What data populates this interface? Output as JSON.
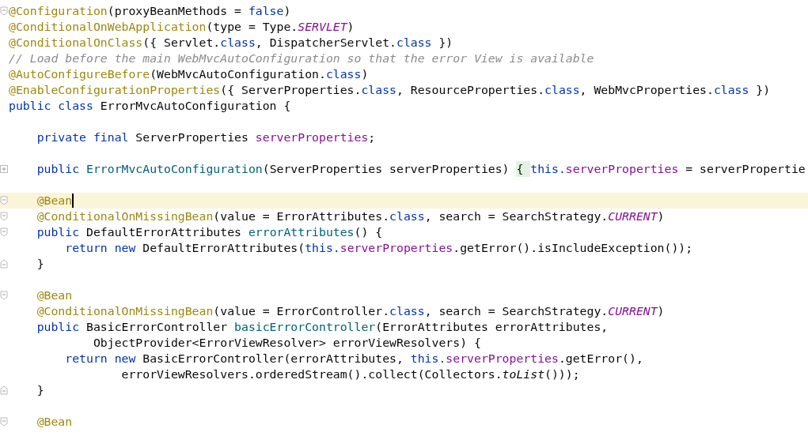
{
  "editor": {
    "lines": [
      {
        "kind": "code",
        "fold_start": true,
        "fold_end": false,
        "collapsed": false,
        "current": false,
        "tokens": [
          {
            "kind": "annotation",
            "text": "@Configuration"
          },
          {
            "kind": "plain",
            "text": "(proxyBeanMethods = "
          },
          {
            "kind": "keyword",
            "text": "false"
          },
          {
            "kind": "plain",
            "text": ")"
          }
        ]
      },
      {
        "kind": "code",
        "fold_start": false,
        "fold_end": false,
        "collapsed": false,
        "current": false,
        "tokens": [
          {
            "kind": "annotation",
            "text": "@ConditionalOnWebApplication"
          },
          {
            "kind": "plain",
            "text": "(type = Type."
          },
          {
            "kind": "constant",
            "text": "SERVLET"
          },
          {
            "kind": "plain",
            "text": ")"
          }
        ]
      },
      {
        "kind": "code",
        "fold_start": false,
        "fold_end": false,
        "collapsed": false,
        "current": false,
        "tokens": [
          {
            "kind": "annotation",
            "text": "@ConditionalOnClass"
          },
          {
            "kind": "plain",
            "text": "({ Servlet."
          },
          {
            "kind": "keyword",
            "text": "class"
          },
          {
            "kind": "plain",
            "text": ", DispatcherServlet."
          },
          {
            "kind": "keyword",
            "text": "class"
          },
          {
            "kind": "plain",
            "text": " })"
          }
        ]
      },
      {
        "kind": "code",
        "fold_start": false,
        "fold_end": false,
        "collapsed": false,
        "current": false,
        "tokens": [
          {
            "kind": "comment",
            "text": "// Load before the main WebMvcAutoConfiguration so that the error View is available"
          }
        ]
      },
      {
        "kind": "code",
        "fold_start": false,
        "fold_end": false,
        "collapsed": false,
        "current": false,
        "tokens": [
          {
            "kind": "annotation",
            "text": "@AutoConfigureBefore"
          },
          {
            "kind": "plain",
            "text": "(WebMvcAutoConfiguration."
          },
          {
            "kind": "keyword",
            "text": "class"
          },
          {
            "kind": "plain",
            "text": ")"
          }
        ]
      },
      {
        "kind": "code",
        "fold_start": false,
        "fold_end": false,
        "collapsed": false,
        "current": false,
        "tokens": [
          {
            "kind": "annotation",
            "text": "@EnableConfigurationProperties"
          },
          {
            "kind": "plain",
            "text": "({ ServerProperties."
          },
          {
            "kind": "keyword",
            "text": "class"
          },
          {
            "kind": "plain",
            "text": ", ResourceProperties."
          },
          {
            "kind": "keyword",
            "text": "class"
          },
          {
            "kind": "plain",
            "text": ", WebMvcProperties."
          },
          {
            "kind": "keyword",
            "text": "class"
          },
          {
            "kind": "plain",
            "text": " })"
          }
        ]
      },
      {
        "kind": "code",
        "fold_start": false,
        "fold_end": false,
        "collapsed": false,
        "current": false,
        "tokens": [
          {
            "kind": "keyword",
            "text": "public class "
          },
          {
            "kind": "plain",
            "text": "ErrorMvcAutoConfiguration {"
          }
        ]
      },
      {
        "kind": "blank",
        "fold_start": false,
        "fold_end": false,
        "collapsed": false,
        "current": false
      },
      {
        "kind": "code",
        "fold_start": false,
        "fold_end": false,
        "collapsed": false,
        "current": false,
        "tokens": [
          {
            "kind": "keyword",
            "text": "    private final "
          },
          {
            "kind": "plain",
            "text": "ServerProperties "
          },
          {
            "kind": "field",
            "text": "serverProperties"
          },
          {
            "kind": "plain",
            "text": ";"
          }
        ]
      },
      {
        "kind": "blank",
        "fold_start": false,
        "fold_end": false,
        "collapsed": false,
        "current": false
      },
      {
        "kind": "code",
        "fold_start": false,
        "fold_end": false,
        "collapsed": true,
        "current": false,
        "tokens": [
          {
            "kind": "keyword",
            "text": "    public "
          },
          {
            "kind": "method",
            "text": "ErrorMvcAutoConfiguration"
          },
          {
            "kind": "plain",
            "text": "(ServerProperties serverProperties) "
          },
          {
            "kind": "folded",
            "text": "{ "
          },
          {
            "kind": "keyword",
            "text": "this."
          },
          {
            "kind": "field",
            "text": "serverProperties"
          },
          {
            "kind": "plain",
            "text": " = serverPropertie"
          }
        ]
      },
      {
        "kind": "blank",
        "fold_start": false,
        "fold_end": false,
        "collapsed": false,
        "current": false
      },
      {
        "kind": "code",
        "fold_start": true,
        "fold_end": false,
        "collapsed": false,
        "current": true,
        "tokens": [
          {
            "kind": "annotation",
            "text": "    @Bean"
          }
        ]
      },
      {
        "kind": "code",
        "fold_start": true,
        "fold_end": false,
        "collapsed": false,
        "current": false,
        "tokens": [
          {
            "kind": "annotation",
            "text": "    @ConditionalOnMissingBean"
          },
          {
            "kind": "plain",
            "text": "(value = ErrorAttributes."
          },
          {
            "kind": "keyword",
            "text": "class"
          },
          {
            "kind": "plain",
            "text": ", search = SearchStrategy."
          },
          {
            "kind": "constant",
            "text": "CURRENT"
          },
          {
            "kind": "plain",
            "text": ")"
          }
        ]
      },
      {
        "kind": "code",
        "fold_start": true,
        "fold_end": false,
        "collapsed": false,
        "current": false,
        "tokens": [
          {
            "kind": "keyword",
            "text": "    public "
          },
          {
            "kind": "plain",
            "text": "DefaultErrorAttributes "
          },
          {
            "kind": "method",
            "text": "errorAttributes"
          },
          {
            "kind": "plain",
            "text": "() {"
          }
        ]
      },
      {
        "kind": "code",
        "fold_start": false,
        "fold_end": false,
        "collapsed": false,
        "current": false,
        "tokens": [
          {
            "kind": "keyword",
            "text": "        return new "
          },
          {
            "kind": "plain",
            "text": "DefaultErrorAttributes("
          },
          {
            "kind": "keyword",
            "text": "this."
          },
          {
            "kind": "field",
            "text": "serverProperties"
          },
          {
            "kind": "plain",
            "text": ".getError().isIncludeException());"
          }
        ]
      },
      {
        "kind": "code",
        "fold_start": false,
        "fold_end": true,
        "collapsed": false,
        "current": false,
        "tokens": [
          {
            "kind": "plain",
            "text": "    }"
          }
        ]
      },
      {
        "kind": "blank",
        "fold_start": false,
        "fold_end": false,
        "collapsed": false,
        "current": false
      },
      {
        "kind": "code",
        "fold_start": true,
        "fold_end": false,
        "collapsed": false,
        "current": false,
        "tokens": [
          {
            "kind": "annotation",
            "text": "    @Bean"
          }
        ]
      },
      {
        "kind": "code",
        "fold_start": false,
        "fold_end": false,
        "collapsed": false,
        "current": false,
        "tokens": [
          {
            "kind": "annotation",
            "text": "    @ConditionalOnMissingBean"
          },
          {
            "kind": "plain",
            "text": "(value = ErrorController."
          },
          {
            "kind": "keyword",
            "text": "class"
          },
          {
            "kind": "plain",
            "text": ", search = SearchStrategy."
          },
          {
            "kind": "constant",
            "text": "CURRENT"
          },
          {
            "kind": "plain",
            "text": ")"
          }
        ]
      },
      {
        "kind": "code",
        "fold_start": false,
        "fold_end": false,
        "collapsed": false,
        "current": false,
        "tokens": [
          {
            "kind": "keyword",
            "text": "    public "
          },
          {
            "kind": "plain",
            "text": "BasicErrorController "
          },
          {
            "kind": "method",
            "text": "basicErrorController"
          },
          {
            "kind": "plain",
            "text": "(ErrorAttributes errorAttributes,"
          }
        ]
      },
      {
        "kind": "code",
        "fold_start": false,
        "fold_end": false,
        "collapsed": false,
        "current": false,
        "tokens": [
          {
            "kind": "plain",
            "text": "            ObjectProvider<ErrorViewResolver> errorViewResolvers) {"
          }
        ]
      },
      {
        "kind": "code",
        "fold_start": false,
        "fold_end": false,
        "collapsed": false,
        "current": false,
        "tokens": [
          {
            "kind": "keyword",
            "text": "        return new "
          },
          {
            "kind": "plain",
            "text": "BasicErrorController(errorAttributes, "
          },
          {
            "kind": "keyword",
            "text": "this."
          },
          {
            "kind": "field",
            "text": "serverProperties"
          },
          {
            "kind": "plain",
            "text": ".getError(),"
          }
        ]
      },
      {
        "kind": "code",
        "fold_start": false,
        "fold_end": false,
        "collapsed": false,
        "current": false,
        "tokens": [
          {
            "kind": "plain",
            "text": "                errorViewResolvers.orderedStream().collect(Collectors."
          },
          {
            "kind": "static",
            "text": "toList"
          },
          {
            "kind": "plain",
            "text": "()));"
          }
        ]
      },
      {
        "kind": "code",
        "fold_start": false,
        "fold_end": true,
        "collapsed": false,
        "current": false,
        "tokens": [
          {
            "kind": "plain",
            "text": "    }"
          }
        ]
      },
      {
        "kind": "blank",
        "fold_start": false,
        "fold_end": false,
        "collapsed": false,
        "current": false
      },
      {
        "kind": "code",
        "fold_start": true,
        "fold_end": false,
        "collapsed": false,
        "current": false,
        "tokens": [
          {
            "kind": "annotation",
            "text": "    @Bean"
          }
        ]
      }
    ]
  }
}
